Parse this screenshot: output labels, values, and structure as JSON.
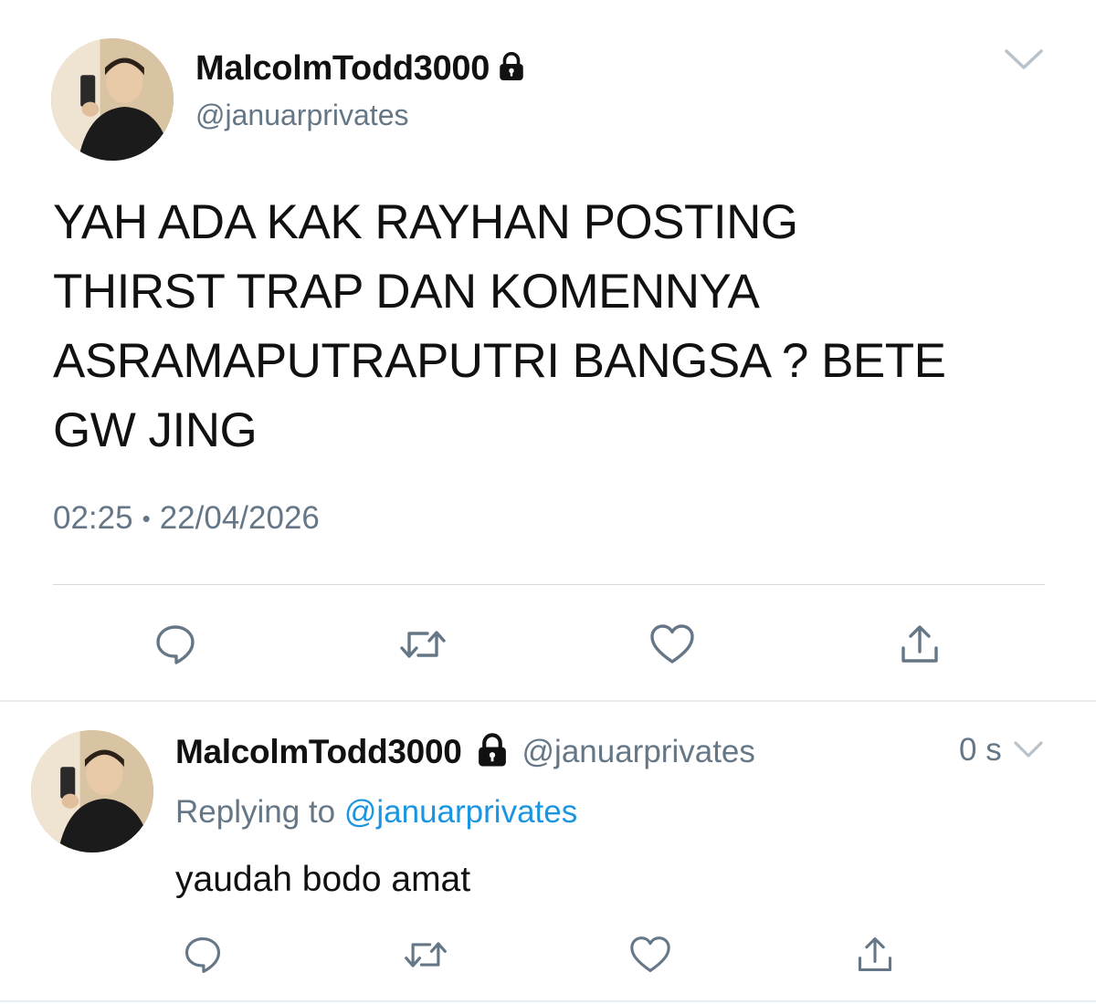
{
  "main_tweet": {
    "display_name": "MalcolmTodd3000",
    "handle": "@januarprivates",
    "text": "YAH ADA KAK RAYHAN POSTING\nTHIRST TRAP DAN KOMENNYA\nASRAMAPUTRAPUTRI BANGSA ? BETE\nGW JING",
    "time": "02:25",
    "separator": "•",
    "date": "22/04/2026",
    "protected_icon": "lock-icon",
    "menu_icon": "chevron-down-icon",
    "actions": [
      "reply-icon",
      "retweet-icon",
      "like-icon",
      "share-icon"
    ]
  },
  "reply_tweet": {
    "display_name": "MalcolmTodd3000",
    "handle": "@januarprivates",
    "relative_time": "0 s",
    "replying_prefix": "Replying to",
    "replying_to": "@januarprivates",
    "text": "yaudah bodo amat",
    "protected_icon": "lock-icon",
    "menu_icon": "chevron-down-icon",
    "actions": [
      "reply-icon",
      "retweet-icon",
      "like-icon",
      "share-icon"
    ]
  },
  "colors": {
    "text_primary": "#111111",
    "text_secondary": "#657786",
    "link": "#1b95e0",
    "divider": "#e6ecf0",
    "icon": "#657786"
  }
}
